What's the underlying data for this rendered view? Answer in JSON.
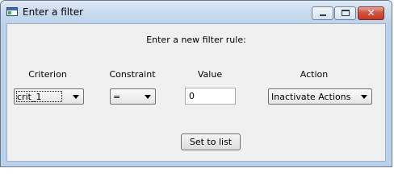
{
  "window": {
    "title": "Enter a filter",
    "icons": {
      "app": "window-app-icon",
      "minimize": "minimize-icon",
      "maximize": "maximize-icon",
      "close": "close-icon"
    },
    "close_glyph": "✕"
  },
  "form": {
    "heading": "Enter a new filter rule:",
    "labels": {
      "criterion": "Criterion",
      "constraint": "Constraint",
      "value": "Value",
      "action": "Action"
    },
    "criterion_selected": "crit_1",
    "constraint_selected": "=",
    "value": "0",
    "action_selected": "Inactivate Actions",
    "submit_label": "Set to list"
  },
  "colors": {
    "titlebar": "#c9dbee",
    "client_bg": "#f0f0f0",
    "close_button": "#c43a22"
  }
}
